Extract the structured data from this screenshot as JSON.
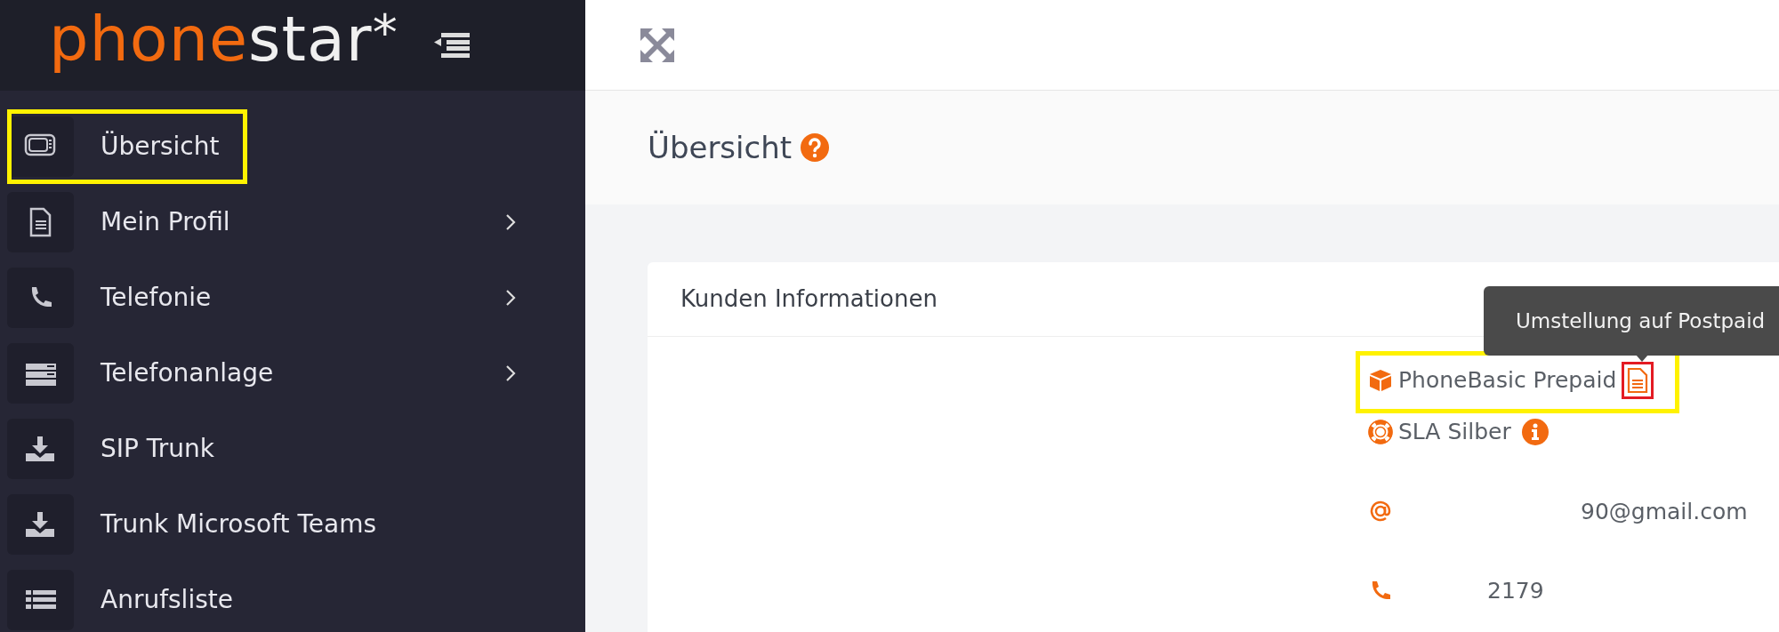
{
  "brand": {
    "part_1": "phone",
    "part_2": "star",
    "mark": "*"
  },
  "sidebar": {
    "items": [
      {
        "label": "Übersicht",
        "has_submenu": false,
        "highlighted": true
      },
      {
        "label": "Mein Profil",
        "has_submenu": true,
        "highlighted": false
      },
      {
        "label": "Telefonie",
        "has_submenu": true,
        "highlighted": false
      },
      {
        "label": "Telefonanlage",
        "has_submenu": true,
        "highlighted": false
      },
      {
        "label": "SIP Trunk",
        "has_submenu": false,
        "highlighted": false
      },
      {
        "label": "Trunk Microsoft Teams",
        "has_submenu": false,
        "highlighted": false
      },
      {
        "label": "Anrufsliste",
        "has_submenu": false,
        "highlighted": false
      }
    ]
  },
  "page_title": "Übersicht",
  "card": {
    "title": "Kunden Informationen",
    "rows": [
      {
        "kind": "product",
        "text": "PhoneBasic Prepaid",
        "highlighted": true,
        "action_marked": true
      },
      {
        "kind": "sla",
        "text": "SLA Silber"
      },
      {
        "kind": "email",
        "text": "90@gmail.com"
      },
      {
        "kind": "phone",
        "text": "2179"
      }
    ]
  },
  "tooltip": {
    "text": "Umstellung auf Postpaid"
  }
}
